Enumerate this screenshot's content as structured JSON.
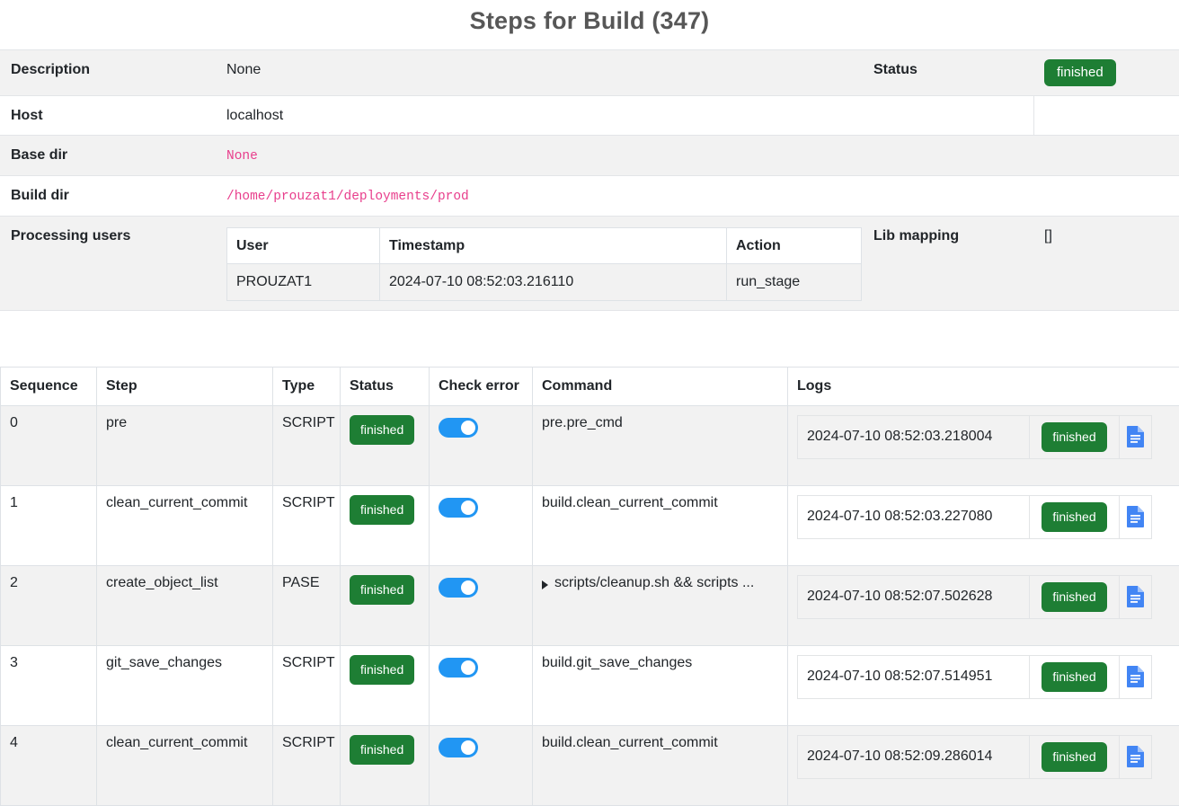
{
  "page": {
    "title": "Steps for Build (347)"
  },
  "info": {
    "rows": [
      {
        "label": "Description",
        "value": "None",
        "label2": "Status",
        "badge": "finished"
      },
      {
        "label": "Host",
        "value": "localhost"
      },
      {
        "label": "Base dir",
        "value": "None"
      },
      {
        "label": "Build dir",
        "value": "/home/prouzat1/deployments/prod"
      },
      {
        "label": "Processing users",
        "label2": "Lib mapping",
        "value2": "[]"
      }
    ],
    "users_table": {
      "headers": [
        "User",
        "Timestamp",
        "Action"
      ],
      "rows": [
        {
          "user": "PROUZAT1",
          "timestamp": "2024-07-10 08:52:03.216110",
          "action": "run_stage"
        }
      ]
    }
  },
  "steps": {
    "headers": [
      "Sequence",
      "Step",
      "Type",
      "Status",
      "Check error",
      "Command",
      "Logs"
    ],
    "rows": [
      {
        "sequence": "0",
        "step": "pre",
        "type": "SCRIPT",
        "status": "finished",
        "check_error": "on",
        "command": "pre.pre_cmd",
        "command_collapsible": false,
        "logs": [
          {
            "timestamp": "2024-07-10 08:52:03.218004",
            "status": "finished",
            "icon": "document-icon"
          }
        ]
      },
      {
        "sequence": "1",
        "step": "clean_current_commit",
        "type": "SCRIPT",
        "status": "finished",
        "check_error": "on",
        "command": "build.clean_current_commit",
        "command_collapsible": false,
        "logs": [
          {
            "timestamp": "2024-07-10 08:52:03.227080",
            "status": "finished",
            "icon": "document-icon"
          }
        ]
      },
      {
        "sequence": "2",
        "step": "create_object_list",
        "type": "PASE",
        "status": "finished",
        "check_error": "on",
        "command": "scripts/cleanup.sh && scripts ...",
        "command_collapsible": true,
        "logs": [
          {
            "timestamp": "2024-07-10 08:52:07.502628",
            "status": "finished",
            "icon": "document-icon"
          }
        ]
      },
      {
        "sequence": "3",
        "step": "git_save_changes",
        "type": "SCRIPT",
        "status": "finished",
        "check_error": "on",
        "command": "build.git_save_changes",
        "command_collapsible": false,
        "logs": [
          {
            "timestamp": "2024-07-10 08:52:07.514951",
            "status": "finished",
            "icon": "document-icon"
          }
        ]
      },
      {
        "sequence": "4",
        "step": "clean_current_commit",
        "type": "SCRIPT",
        "status": "finished",
        "check_error": "on",
        "command": "build.clean_current_commit",
        "command_collapsible": false,
        "logs": [
          {
            "timestamp": "2024-07-10 08:52:09.286014",
            "status": "finished",
            "icon": "document-icon"
          }
        ]
      }
    ]
  },
  "colors": {
    "status_green": "#1e7e34",
    "toggle_blue": "#2196f3",
    "code_pink": "#e83e8c",
    "title_gray": "#575757",
    "doc_icon_blue": "#4285f4"
  }
}
